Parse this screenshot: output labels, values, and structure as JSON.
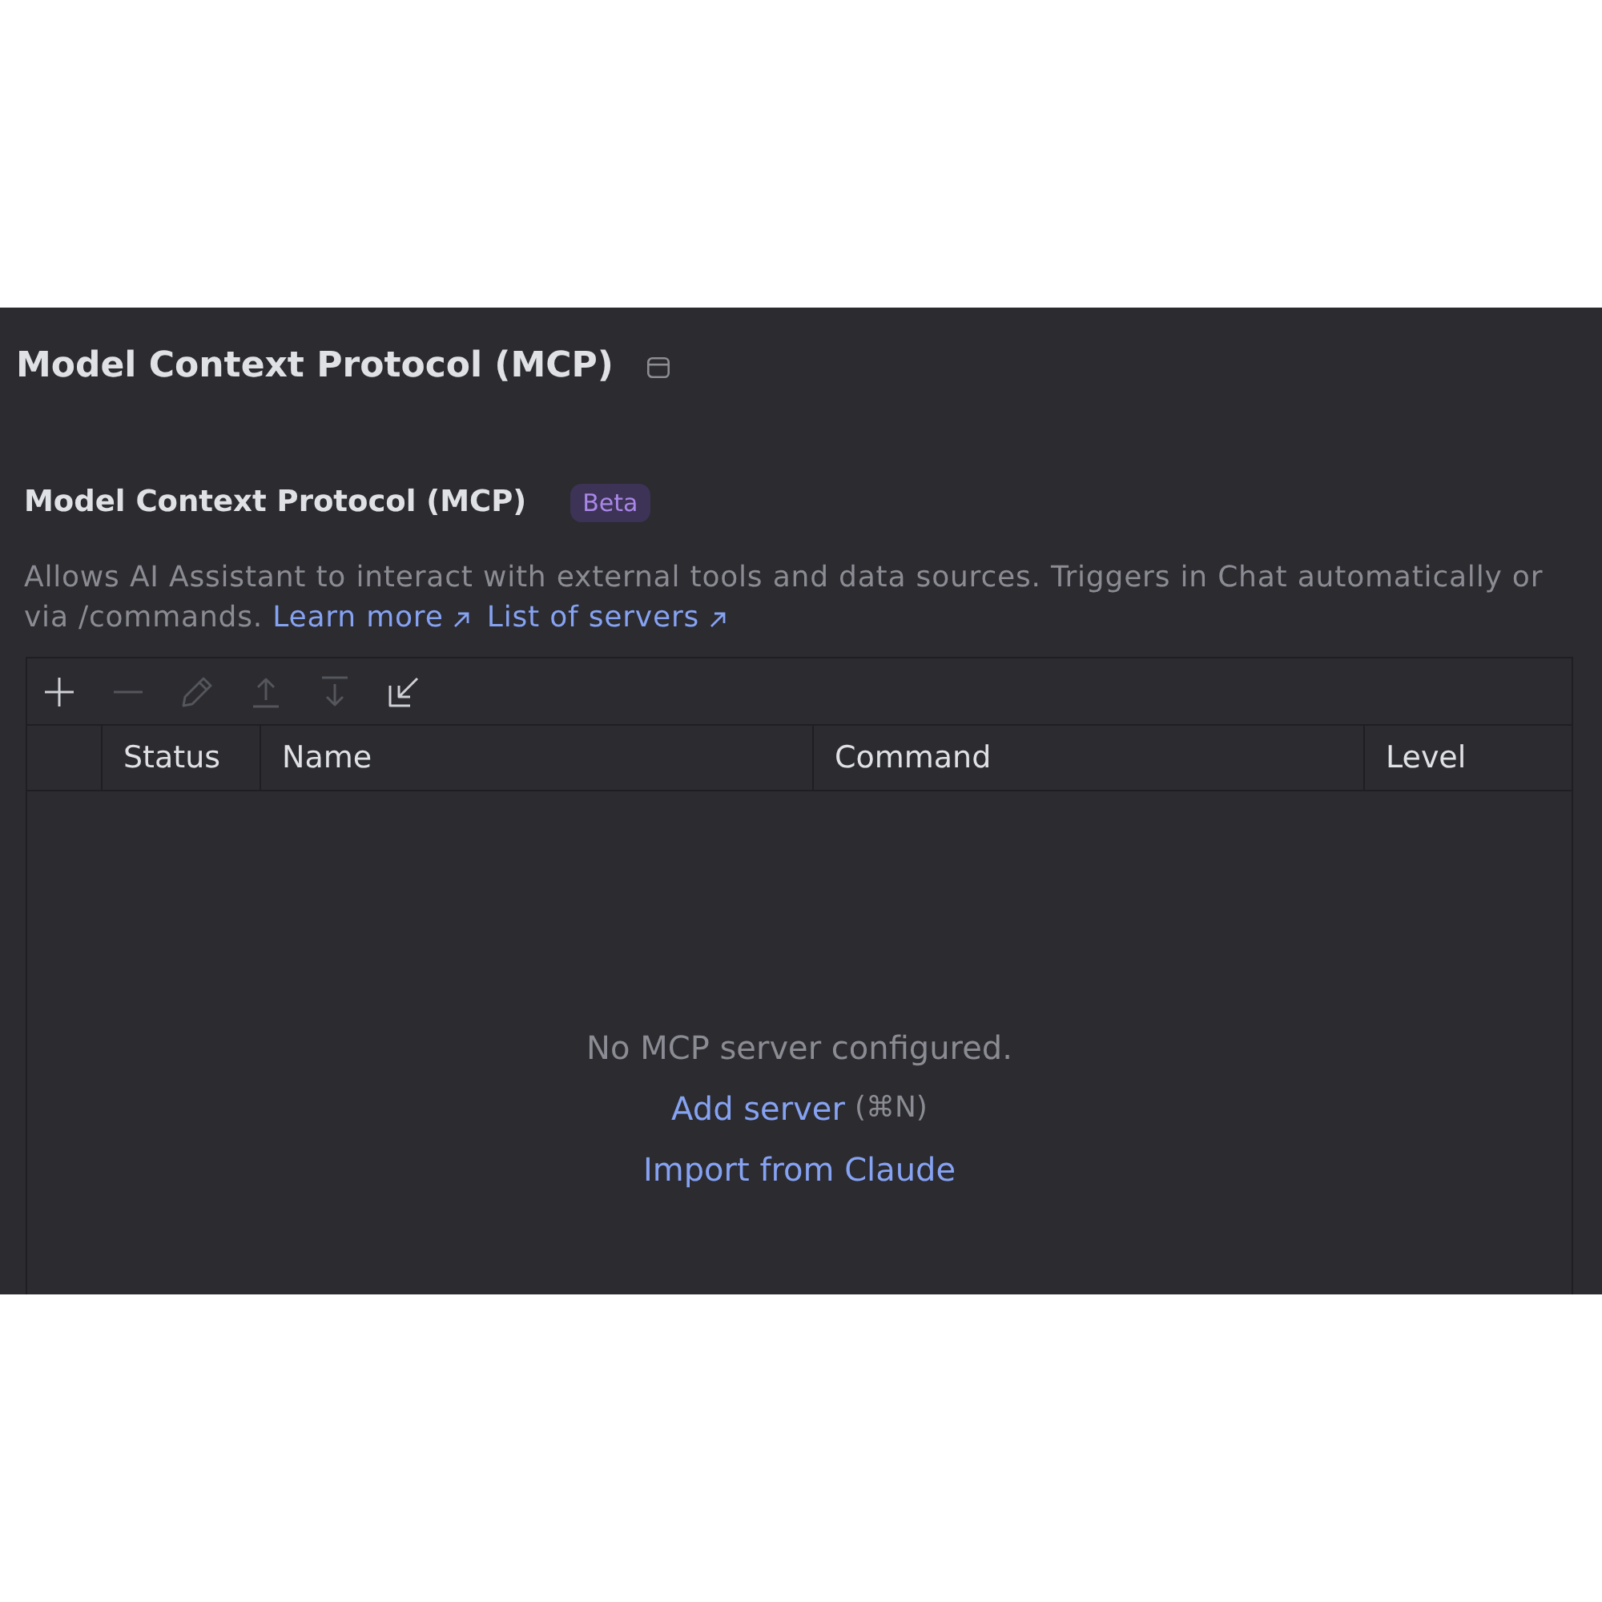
{
  "page": {
    "title": "Model Context Protocol (MCP)"
  },
  "section": {
    "title": "Model Context Protocol (MCP)",
    "badge": "Beta",
    "description": "Allows AI Assistant to interact with external tools and data sources. Triggers in Chat automatically or via /commands.",
    "links": [
      {
        "label": "Learn more"
      },
      {
        "label": "List of servers"
      }
    ]
  },
  "toolbar": [
    {
      "kind": "add",
      "disabled": false
    },
    {
      "kind": "remove",
      "disabled": true
    },
    {
      "kind": "edit",
      "disabled": true
    },
    {
      "kind": "up",
      "disabled": true
    },
    {
      "kind": "down",
      "disabled": true
    },
    {
      "kind": "import",
      "disabled": false
    }
  ],
  "table": {
    "columns": [
      "Status",
      "Name",
      "Command",
      "Level"
    ],
    "empty_state": {
      "message": "No MCP server configured.",
      "add_link": "Add server",
      "shortcut": "(⌘N)",
      "import_link": "Import from Claude"
    }
  }
}
